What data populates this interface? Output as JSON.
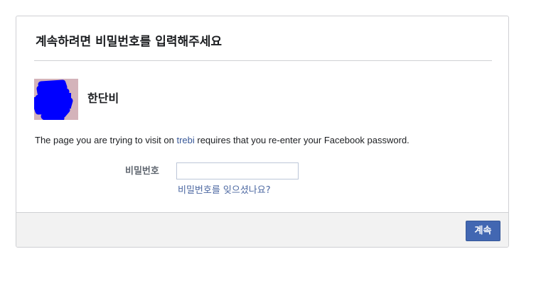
{
  "dialog": {
    "title": "계속하려면 비밀번호를 입력해주세요"
  },
  "profile": {
    "name": "한단비"
  },
  "message": {
    "before": "The page you are trying to visit on ",
    "app_link": "trebi",
    "after": " requires that you re-enter your Facebook password."
  },
  "password": {
    "label": "비밀번호",
    "value": "",
    "placeholder": ""
  },
  "forgot_link": "비밀번호를 잊으셨나요?",
  "footer": {
    "continue_label": "계속"
  },
  "colors": {
    "link": "#385898",
    "button": "#4267b2",
    "footer_bg": "#f2f2f2",
    "redaction": "#0000ff"
  },
  "icons": {
    "avatar": "profile-photo-redacted"
  }
}
